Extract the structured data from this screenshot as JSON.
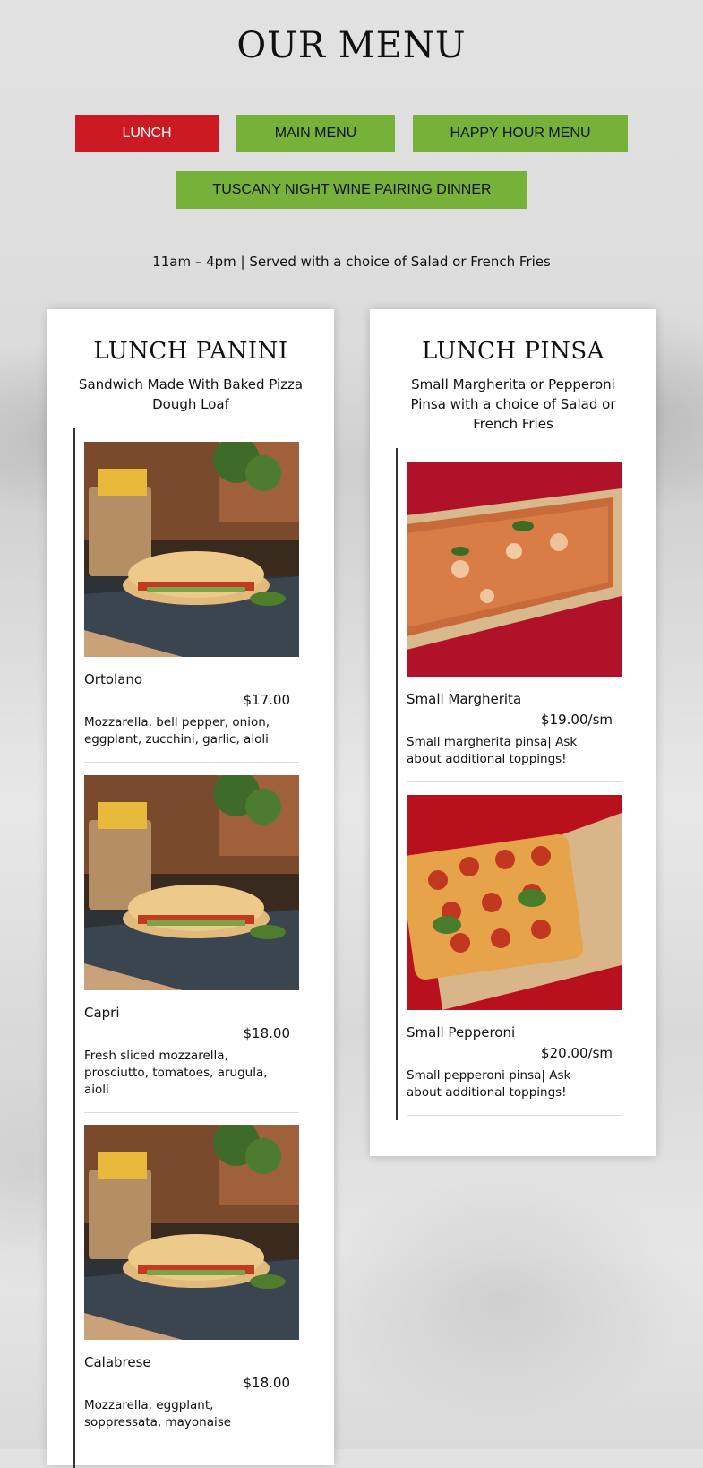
{
  "page_title": "OUR MENU",
  "tabs": [
    {
      "label": "LUNCH",
      "active": true
    },
    {
      "label": "MAIN MENU",
      "active": false
    },
    {
      "label": "HAPPY HOUR MENU",
      "active": false
    },
    {
      "label": "TUSCANY NIGHT WINE PAIRING DINNER",
      "active": false
    }
  ],
  "hours_text": "11am – 4pm | Served with a choice of Salad or French Fries",
  "colors": {
    "active_tab": "#cc1a22",
    "inactive_tab": "#76b13a"
  },
  "sections": [
    {
      "title": "LUNCH PANINI",
      "subtitle": "Sandwich Made With Baked Pizza Dough Loaf",
      "items": [
        {
          "name": "Ortolano",
          "price": "$17.00",
          "description": "Mozzarella, bell pepper, onion, eggplant, zucchini, garlic, aioli",
          "image": "panini-photo"
        },
        {
          "name": "Capri",
          "price": "$18.00",
          "description": "Fresh sliced mozzarella, prosciutto, tomatoes, arugula, aioli",
          "image": "panini-photo"
        },
        {
          "name": "Calabrese",
          "price": "$18.00",
          "description": "Mozzarella, eggplant, soppressata, mayonaise",
          "image": "panini-photo"
        }
      ]
    },
    {
      "title": "LUNCH PINSA",
      "subtitle": "Small Margherita or Pepperoni Pinsa with a choice of Salad or French Fries",
      "items": [
        {
          "name": "Small Margherita",
          "price": "$19.00/sm",
          "description": "Small margherita pinsa| Ask about additional toppings!",
          "image": "margherita-pinsa-photo"
        },
        {
          "name": "Small Pepperoni",
          "price": "$20.00/sm",
          "description": "Small pepperoni pinsa| Ask about additional toppings!",
          "image": "pepperoni-pinsa-photo"
        }
      ]
    }
  ]
}
